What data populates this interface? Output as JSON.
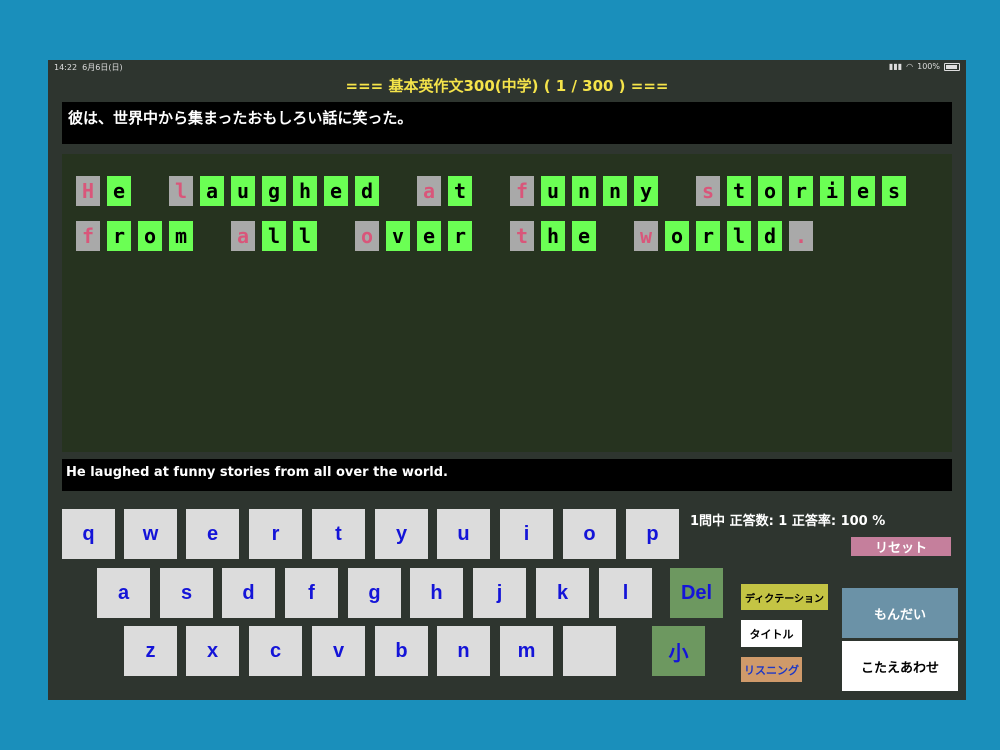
{
  "status": {
    "time": "14:22",
    "date": "6月6日(日)",
    "battery": "100%"
  },
  "title": "===  基本英作文300(中学) ( 1 / 300 )  ===",
  "japanese_sentence": "彼は、世界中から集まったおもしろい話に笑った。",
  "answer_lines": [
    [
      {
        "ch": "H",
        "state": "miss"
      },
      {
        "ch": "e",
        "state": "ok"
      },
      {
        "ch": "",
        "state": "gap"
      },
      {
        "ch": "l",
        "state": "miss"
      },
      {
        "ch": "a",
        "state": "ok"
      },
      {
        "ch": "u",
        "state": "ok"
      },
      {
        "ch": "g",
        "state": "ok"
      },
      {
        "ch": "h",
        "state": "ok"
      },
      {
        "ch": "e",
        "state": "ok"
      },
      {
        "ch": "d",
        "state": "ok"
      },
      {
        "ch": "",
        "state": "gap"
      },
      {
        "ch": "a",
        "state": "miss"
      },
      {
        "ch": "t",
        "state": "ok"
      },
      {
        "ch": "",
        "state": "gap"
      },
      {
        "ch": "f",
        "state": "miss"
      },
      {
        "ch": "u",
        "state": "ok"
      },
      {
        "ch": "n",
        "state": "ok"
      },
      {
        "ch": "n",
        "state": "ok"
      },
      {
        "ch": "y",
        "state": "ok"
      },
      {
        "ch": "",
        "state": "gap"
      },
      {
        "ch": "s",
        "state": "miss"
      },
      {
        "ch": "t",
        "state": "ok"
      },
      {
        "ch": "o",
        "state": "ok"
      },
      {
        "ch": "r",
        "state": "ok"
      },
      {
        "ch": "i",
        "state": "ok"
      },
      {
        "ch": "e",
        "state": "ok"
      },
      {
        "ch": "s",
        "state": "ok"
      }
    ],
    [
      {
        "ch": "f",
        "state": "miss"
      },
      {
        "ch": "r",
        "state": "ok"
      },
      {
        "ch": "o",
        "state": "ok"
      },
      {
        "ch": "m",
        "state": "ok"
      },
      {
        "ch": "",
        "state": "gap"
      },
      {
        "ch": "a",
        "state": "miss"
      },
      {
        "ch": "l",
        "state": "ok"
      },
      {
        "ch": "l",
        "state": "ok"
      },
      {
        "ch": "",
        "state": "gap"
      },
      {
        "ch": "o",
        "state": "miss"
      },
      {
        "ch": "v",
        "state": "ok"
      },
      {
        "ch": "e",
        "state": "ok"
      },
      {
        "ch": "r",
        "state": "ok"
      },
      {
        "ch": "",
        "state": "gap"
      },
      {
        "ch": "t",
        "state": "miss"
      },
      {
        "ch": "h",
        "state": "ok"
      },
      {
        "ch": "e",
        "state": "ok"
      },
      {
        "ch": "",
        "state": "gap"
      },
      {
        "ch": "w",
        "state": "miss"
      },
      {
        "ch": "o",
        "state": "ok"
      },
      {
        "ch": "r",
        "state": "ok"
      },
      {
        "ch": "l",
        "state": "ok"
      },
      {
        "ch": "d",
        "state": "ok"
      },
      {
        "ch": ".",
        "state": "miss"
      }
    ]
  ],
  "english_sentence": "He laughed at funny stories from all over the world.",
  "keyboard": {
    "row1": [
      "q",
      "w",
      "e",
      "r",
      "t",
      "y",
      "u",
      "i",
      "o",
      "p"
    ],
    "row2": [
      "a",
      "s",
      "d",
      "f",
      "g",
      "h",
      "j",
      "k",
      "l"
    ],
    "row3": [
      "z",
      "x",
      "c",
      "v",
      "b",
      "n",
      "m",
      ""
    ],
    "del": "Del",
    "small": "小"
  },
  "score_text": "1問中 正答数: 1 正答率: 100 %",
  "buttons": {
    "reset": "リセット",
    "dictation": "ディクテーション",
    "title": "タイトル",
    "listening": "リスニング",
    "question": "もんだい",
    "check": "こたえあわせ"
  },
  "colors": {
    "correct_tile": "#6bff54",
    "missing_tile": "#a9a9a9",
    "missing_letter": "#d9567a",
    "title_text": "#f5e44a"
  }
}
